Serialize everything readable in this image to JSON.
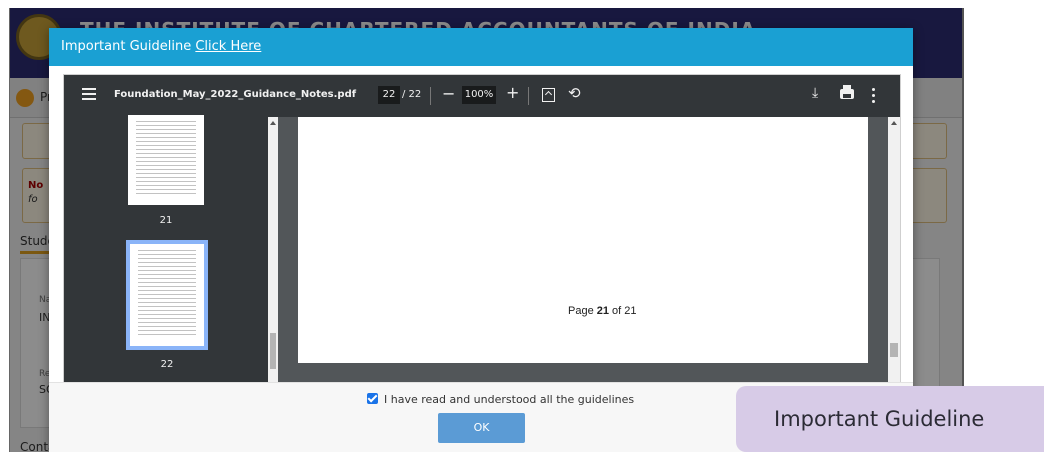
{
  "site": {
    "title": "THE INSTITUTE OF CHARTERED ACCOUNTANTS OF INDIA",
    "nav_text": "Pr",
    "note_text": "No",
    "note_text2": "fo",
    "section_label": "Stude",
    "label_name": "Na",
    "value_name": "INI",
    "label_reg": "Re",
    "value_reg": "SO",
    "footer_label": "Contact Details"
  },
  "modal": {
    "title": "Important Guideline ",
    "link": "Click Here",
    "agree_label": "I have read and understood all the guidelines",
    "ok_label": "OK"
  },
  "pdf": {
    "filename": "Foundation_May_2022_Guidance_Notes.pdf",
    "current_page": "22",
    "total_pages": "/ 22",
    "zoom": "100%",
    "thumbs": [
      "21",
      "22"
    ],
    "page_text_prefix": "Page ",
    "page_text_num": "21",
    "page_text_suffix": " of  21"
  },
  "caption": "Important Guideline",
  "colors": {
    "modal_header": "#1aa0d3",
    "ok_button": "#5b9bd5",
    "pdf_toolbar": "#323639",
    "caption_bg": "#d7cbe7"
  }
}
